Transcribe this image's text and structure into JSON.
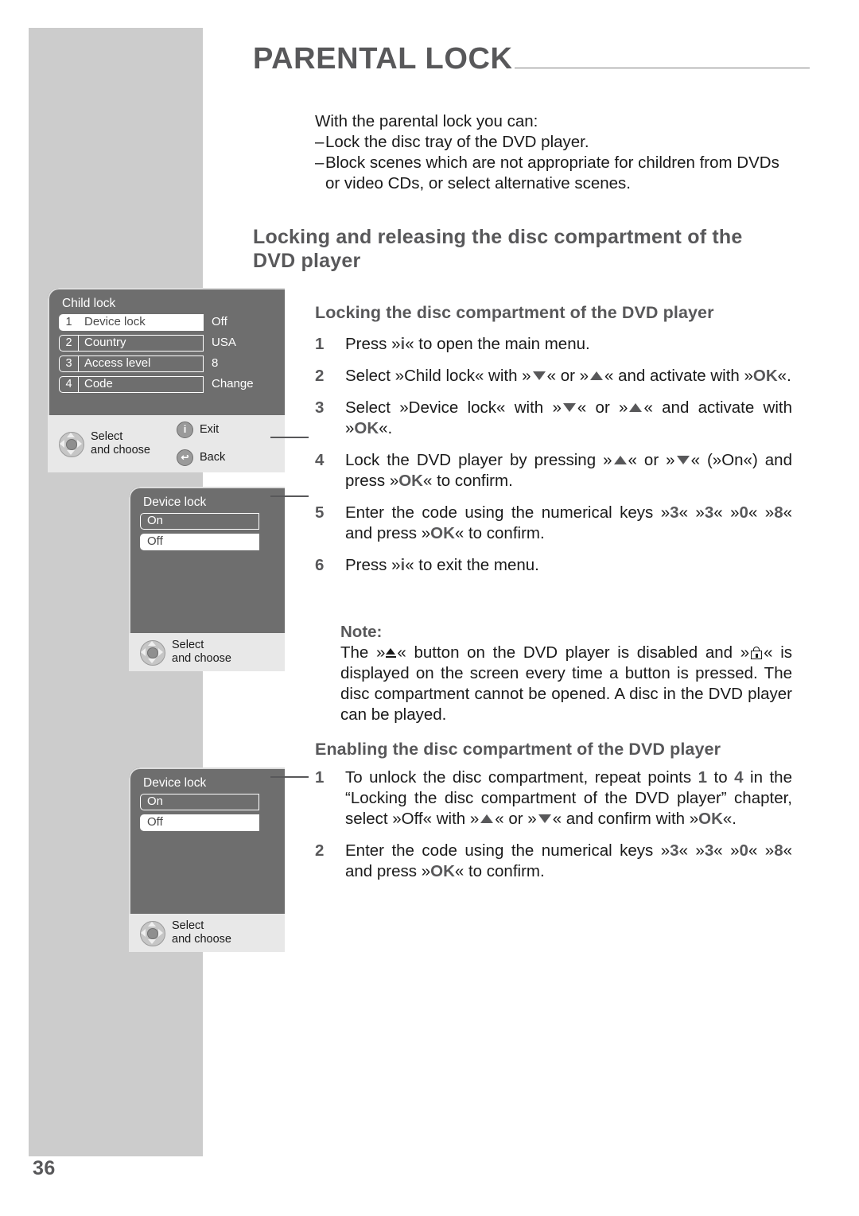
{
  "page": {
    "title": "PARENTAL LOCK",
    "number": "36"
  },
  "intro": {
    "lead": "With the parental lock you can:",
    "bullets": [
      "Lock the disc tray of the DVD player.",
      "Block scenes which are not appropriate for children from DVDs or video CDs, or select alternative scenes."
    ],
    "dash": "–"
  },
  "section": {
    "heading": "Locking and releasing the disc compartment of the DVD player"
  },
  "locking": {
    "heading": "Locking the disc compartment of the DVD player",
    "steps": [
      {
        "num": "1",
        "pre": "Press »",
        "key": "i",
        "post": "« to open the main menu."
      },
      {
        "num": "2",
        "num_label": "2"
      },
      {
        "num": "3",
        "num_label": "3"
      },
      {
        "num": "4",
        "num_label": "4"
      },
      {
        "num": "5",
        "num_label": "5"
      },
      {
        "num": "6",
        "num_label": "6"
      }
    ],
    "step1_text": "Press »i« to open the main menu.",
    "step2": {
      "a": "Select »Child lock« with »",
      "b": "« or »",
      "c": "« and activate with »",
      "ok": "OK",
      "d": "«."
    },
    "step3": {
      "a": "Select »Device lock« with »",
      "b": "« or »",
      "c": "« and activate with »",
      "ok": "OK",
      "d": "«."
    },
    "step4": {
      "a": "Lock the DVD player by pressing »",
      "b": "« or »",
      "c": "« (»On«) and press »",
      "ok": "OK",
      "d": "« to confirm."
    },
    "step5": {
      "a": "Enter the code using the numerical keys »",
      "k1": "3",
      "b": "« »",
      "k2": "3",
      "c": "« »",
      "k3": "0",
      "d": "« »",
      "k4": "8",
      "e": "« and press »",
      "ok": "OK",
      "f": "« to confirm."
    },
    "step6": {
      "a": "Press »",
      "key": "i",
      "b": "« to exit the menu."
    }
  },
  "note": {
    "label": "Note:",
    "a": "The »",
    "b": "« button on the DVD player is disabled and »",
    "c": "« is displayed on the screen every time a button is pressed. The disc compartment cannot be opened. A disc in the DVD player can be played."
  },
  "enabling": {
    "heading": "Enabling the disc compartment of the DVD player",
    "step1": {
      "a": "To unlock the disc compartment, repeat points ",
      "n1": "1",
      "b": " to ",
      "n2": "4",
      "c": " in the “Locking the disc compartment of the DVD player” chapter, select »Off« with »",
      "d": "« or »",
      "e": "« and confirm with »",
      "ok": "OK",
      "f": "«."
    },
    "step2": {
      "a": "Enter the code using the numerical keys »",
      "k1": "3",
      "b": "« »",
      "k2": "3",
      "c": "« »",
      "k3": "0",
      "d": "« »",
      "k4": "8",
      "e": "« and press »",
      "ok": "OK",
      "f": "« to confirm."
    },
    "nums": {
      "one": "1",
      "two": "2"
    }
  },
  "osd_child_lock": {
    "title": "Child lock",
    "rows": [
      {
        "index": "1",
        "label": "Device lock",
        "value": "Off",
        "selected": true
      },
      {
        "index": "2",
        "label": "Country",
        "value": "USA",
        "selected": false
      },
      {
        "index": "3",
        "label": "Access level",
        "value": "8",
        "selected": false
      },
      {
        "index": "4",
        "label": "Code",
        "value": "Change",
        "selected": false
      }
    ],
    "footer": {
      "select_line1": "Select",
      "select_line2": "and choose",
      "exit_glyph": "i",
      "exit_label": "Exit",
      "back_glyph": "↩",
      "back_label": "Back"
    }
  },
  "osd_device_lock_1": {
    "title": "Device lock",
    "options": [
      {
        "label": "On",
        "selected": false
      },
      {
        "label": "Off",
        "selected": true
      }
    ],
    "footer": {
      "select_line1": "Select",
      "select_line2": "and choose"
    }
  },
  "osd_device_lock_2": {
    "title": "Device lock",
    "options": [
      {
        "label": "On",
        "selected": false
      },
      {
        "label": "Off",
        "selected": true
      }
    ],
    "footer": {
      "select_line1": "Select",
      "select_line2": "and choose"
    }
  },
  "colors": {
    "sidebar": "#cccccc",
    "heading": "#58585a",
    "osd_bg": "#6e6e6e",
    "osd_footer": "#e8e8e8",
    "text": "#1a1a1a"
  }
}
